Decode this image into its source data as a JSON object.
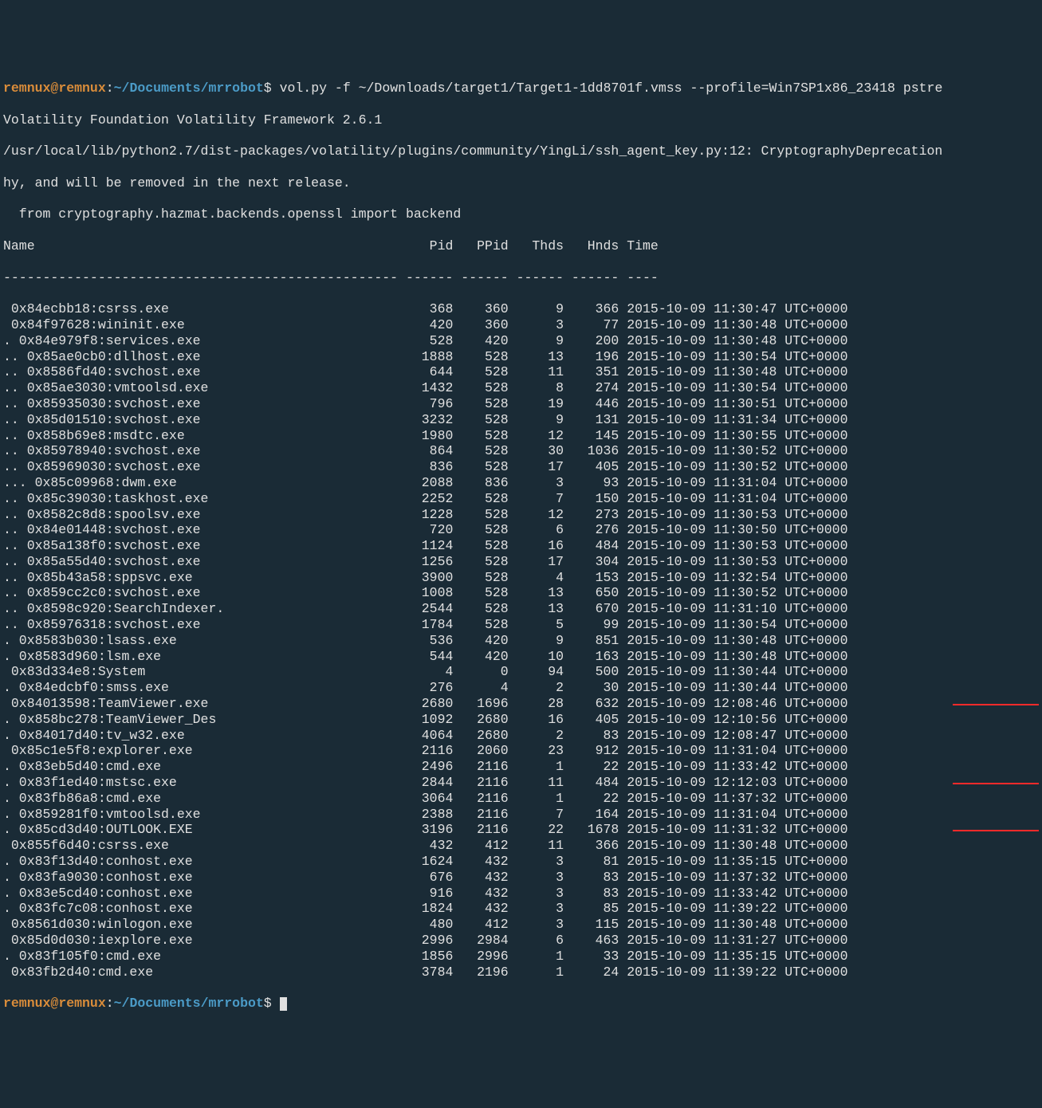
{
  "prompt": {
    "user": "remnux",
    "at": "@",
    "host": "remnux",
    "colon": ":",
    "path": "~/Documents/mrrobot",
    "dollar": "$"
  },
  "command": " vol.py -f ~/Downloads/target1/Target1-1dd8701f.vmss --profile=Win7SP1x86_23418 pstre",
  "header_lines": [
    "Volatility Foundation Volatility Framework 2.6.1",
    "/usr/local/lib/python2.7/dist-packages/volatility/plugins/community/YingLi/ssh_agent_key.py:12: CryptographyDeprecation",
    "hy, and will be removed in the next release.",
    "  from cryptography.hazmat.backends.openssl import backend"
  ],
  "columns": {
    "name": "Name",
    "pid": "Pid",
    "ppid": "PPid",
    "thds": "Thds",
    "hnds": "Hnds",
    "time": "Time"
  },
  "separator": "-------------------------------------------------- ------ ------ ------ ------ ----",
  "rows": [
    {
      "name": " 0x84ecbb18:csrss.exe",
      "pid": "368",
      "ppid": "360",
      "thds": "9",
      "hnds": "366",
      "time": "2015-10-09 11:30:47 UTC+0000",
      "hl": false
    },
    {
      "name": " 0x84f97628:wininit.exe",
      "pid": "420",
      "ppid": "360",
      "thds": "3",
      "hnds": "77",
      "time": "2015-10-09 11:30:48 UTC+0000",
      "hl": false
    },
    {
      "name": ". 0x84e979f8:services.exe",
      "pid": "528",
      "ppid": "420",
      "thds": "9",
      "hnds": "200",
      "time": "2015-10-09 11:30:48 UTC+0000",
      "hl": false
    },
    {
      "name": ".. 0x85ae0cb0:dllhost.exe",
      "pid": "1888",
      "ppid": "528",
      "thds": "13",
      "hnds": "196",
      "time": "2015-10-09 11:30:54 UTC+0000",
      "hl": false
    },
    {
      "name": ".. 0x8586fd40:svchost.exe",
      "pid": "644",
      "ppid": "528",
      "thds": "11",
      "hnds": "351",
      "time": "2015-10-09 11:30:48 UTC+0000",
      "hl": false
    },
    {
      "name": ".. 0x85ae3030:vmtoolsd.exe",
      "pid": "1432",
      "ppid": "528",
      "thds": "8",
      "hnds": "274",
      "time": "2015-10-09 11:30:54 UTC+0000",
      "hl": false
    },
    {
      "name": ".. 0x85935030:svchost.exe",
      "pid": "796",
      "ppid": "528",
      "thds": "19",
      "hnds": "446",
      "time": "2015-10-09 11:30:51 UTC+0000",
      "hl": false
    },
    {
      "name": ".. 0x85d01510:svchost.exe",
      "pid": "3232",
      "ppid": "528",
      "thds": "9",
      "hnds": "131",
      "time": "2015-10-09 11:31:34 UTC+0000",
      "hl": false
    },
    {
      "name": ".. 0x858b69e8:msdtc.exe",
      "pid": "1980",
      "ppid": "528",
      "thds": "12",
      "hnds": "145",
      "time": "2015-10-09 11:30:55 UTC+0000",
      "hl": false
    },
    {
      "name": ".. 0x85978940:svchost.exe",
      "pid": "864",
      "ppid": "528",
      "thds": "30",
      "hnds": "1036",
      "time": "2015-10-09 11:30:52 UTC+0000",
      "hl": false
    },
    {
      "name": ".. 0x85969030:svchost.exe",
      "pid": "836",
      "ppid": "528",
      "thds": "17",
      "hnds": "405",
      "time": "2015-10-09 11:30:52 UTC+0000",
      "hl": false
    },
    {
      "name": "... 0x85c09968:dwm.exe",
      "pid": "2088",
      "ppid": "836",
      "thds": "3",
      "hnds": "93",
      "time": "2015-10-09 11:31:04 UTC+0000",
      "hl": false
    },
    {
      "name": ".. 0x85c39030:taskhost.exe",
      "pid": "2252",
      "ppid": "528",
      "thds": "7",
      "hnds": "150",
      "time": "2015-10-09 11:31:04 UTC+0000",
      "hl": false
    },
    {
      "name": ".. 0x8582c8d8:spoolsv.exe",
      "pid": "1228",
      "ppid": "528",
      "thds": "12",
      "hnds": "273",
      "time": "2015-10-09 11:30:53 UTC+0000",
      "hl": false
    },
    {
      "name": ".. 0x84e01448:svchost.exe",
      "pid": "720",
      "ppid": "528",
      "thds": "6",
      "hnds": "276",
      "time": "2015-10-09 11:30:50 UTC+0000",
      "hl": false
    },
    {
      "name": ".. 0x85a138f0:svchost.exe",
      "pid": "1124",
      "ppid": "528",
      "thds": "16",
      "hnds": "484",
      "time": "2015-10-09 11:30:53 UTC+0000",
      "hl": false
    },
    {
      "name": ".. 0x85a55d40:svchost.exe",
      "pid": "1256",
      "ppid": "528",
      "thds": "17",
      "hnds": "304",
      "time": "2015-10-09 11:30:53 UTC+0000",
      "hl": false
    },
    {
      "name": ".. 0x85b43a58:sppsvc.exe",
      "pid": "3900",
      "ppid": "528",
      "thds": "4",
      "hnds": "153",
      "time": "2015-10-09 11:32:54 UTC+0000",
      "hl": false
    },
    {
      "name": ".. 0x859cc2c0:svchost.exe",
      "pid": "1008",
      "ppid": "528",
      "thds": "13",
      "hnds": "650",
      "time": "2015-10-09 11:30:52 UTC+0000",
      "hl": false
    },
    {
      "name": ".. 0x8598c920:SearchIndexer.",
      "pid": "2544",
      "ppid": "528",
      "thds": "13",
      "hnds": "670",
      "time": "2015-10-09 11:31:10 UTC+0000",
      "hl": false
    },
    {
      "name": ".. 0x85976318:svchost.exe",
      "pid": "1784",
      "ppid": "528",
      "thds": "5",
      "hnds": "99",
      "time": "2015-10-09 11:30:54 UTC+0000",
      "hl": false
    },
    {
      "name": ". 0x8583b030:lsass.exe",
      "pid": "536",
      "ppid": "420",
      "thds": "9",
      "hnds": "851",
      "time": "2015-10-09 11:30:48 UTC+0000",
      "hl": false
    },
    {
      "name": ". 0x8583d960:lsm.exe",
      "pid": "544",
      "ppid": "420",
      "thds": "10",
      "hnds": "163",
      "time": "2015-10-09 11:30:48 UTC+0000",
      "hl": false
    },
    {
      "name": " 0x83d334e8:System",
      "pid": "4",
      "ppid": "0",
      "thds": "94",
      "hnds": "500",
      "time": "2015-10-09 11:30:44 UTC+0000",
      "hl": false
    },
    {
      "name": ". 0x84edcbf0:smss.exe",
      "pid": "276",
      "ppid": "4",
      "thds": "2",
      "hnds": "30",
      "time": "2015-10-09 11:30:44 UTC+0000",
      "hl": false
    },
    {
      "name": " 0x84013598:TeamViewer.exe",
      "pid": "2680",
      "ppid": "1696",
      "thds": "28",
      "hnds": "632",
      "time": "2015-10-09 12:08:46 UTC+0000",
      "hl": true,
      "hlw": "108"
    },
    {
      "name": ". 0x858bc278:TeamViewer_Des",
      "pid": "1092",
      "ppid": "2680",
      "thds": "16",
      "hnds": "405",
      "time": "2015-10-09 12:10:56 UTC+0000",
      "hl": false
    },
    {
      "name": ". 0x84017d40:tv_w32.exe",
      "pid": "4064",
      "ppid": "2680",
      "thds": "2",
      "hnds": "83",
      "time": "2015-10-09 12:08:47 UTC+0000",
      "hl": false
    },
    {
      "name": " 0x85c1e5f8:explorer.exe",
      "pid": "2116",
      "ppid": "2060",
      "thds": "23",
      "hnds": "912",
      "time": "2015-10-09 11:31:04 UTC+0000",
      "hl": false
    },
    {
      "name": ". 0x83eb5d40:cmd.exe",
      "pid": "2496",
      "ppid": "2116",
      "thds": "1",
      "hnds": "22",
      "time": "2015-10-09 11:33:42 UTC+0000",
      "hl": false
    },
    {
      "name": ". 0x83f1ed40:mstsc.exe",
      "pid": "2844",
      "ppid": "2116",
      "thds": "11",
      "hnds": "484",
      "time": "2015-10-09 12:12:03 UTC+0000",
      "hl": true,
      "hlw": "108"
    },
    {
      "name": ". 0x83fb86a8:cmd.exe",
      "pid": "3064",
      "ppid": "2116",
      "thds": "1",
      "hnds": "22",
      "time": "2015-10-09 11:37:32 UTC+0000",
      "hl": false
    },
    {
      "name": ". 0x859281f0:vmtoolsd.exe",
      "pid": "2388",
      "ppid": "2116",
      "thds": "7",
      "hnds": "164",
      "time": "2015-10-09 11:31:04 UTC+0000",
      "hl": false
    },
    {
      "name": ". 0x85cd3d40:OUTLOOK.EXE",
      "pid": "3196",
      "ppid": "2116",
      "thds": "22",
      "hnds": "1678",
      "time": "2015-10-09 11:31:32 UTC+0000",
      "hl": true,
      "hlw": "108"
    },
    {
      "name": " 0x855f6d40:csrss.exe",
      "pid": "432",
      "ppid": "412",
      "thds": "11",
      "hnds": "366",
      "time": "2015-10-09 11:30:48 UTC+0000",
      "hl": false
    },
    {
      "name": ". 0x83f13d40:conhost.exe",
      "pid": "1624",
      "ppid": "432",
      "thds": "3",
      "hnds": "81",
      "time": "2015-10-09 11:35:15 UTC+0000",
      "hl": false
    },
    {
      "name": ". 0x83fa9030:conhost.exe",
      "pid": "676",
      "ppid": "432",
      "thds": "3",
      "hnds": "83",
      "time": "2015-10-09 11:37:32 UTC+0000",
      "hl": false
    },
    {
      "name": ". 0x83e5cd40:conhost.exe",
      "pid": "916",
      "ppid": "432",
      "thds": "3",
      "hnds": "83",
      "time": "2015-10-09 11:33:42 UTC+0000",
      "hl": false
    },
    {
      "name": ". 0x83fc7c08:conhost.exe",
      "pid": "1824",
      "ppid": "432",
      "thds": "3",
      "hnds": "85",
      "time": "2015-10-09 11:39:22 UTC+0000",
      "hl": false
    },
    {
      "name": " 0x8561d030:winlogon.exe",
      "pid": "480",
      "ppid": "412",
      "thds": "3",
      "hnds": "115",
      "time": "2015-10-09 11:30:48 UTC+0000",
      "hl": false
    },
    {
      "name": " 0x85d0d030:iexplore.exe",
      "pid": "2996",
      "ppid": "2984",
      "thds": "6",
      "hnds": "463",
      "time": "2015-10-09 11:31:27 UTC+0000",
      "hl": false
    },
    {
      "name": ". 0x83f105f0:cmd.exe",
      "pid": "1856",
      "ppid": "2996",
      "thds": "1",
      "hnds": "33",
      "time": "2015-10-09 11:35:15 UTC+0000",
      "hl": false
    },
    {
      "name": " 0x83fb2d40:cmd.exe",
      "pid": "3784",
      "ppid": "2196",
      "thds": "1",
      "hnds": "24",
      "time": "2015-10-09 11:39:22 UTC+0000",
      "hl": false
    }
  ]
}
